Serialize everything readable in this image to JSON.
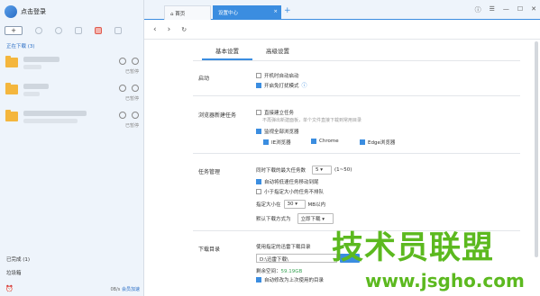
{
  "sidebar": {
    "login_label": "点击登录",
    "toolbar": {
      "add_label": "+"
    },
    "section_label": "正在下载 (3)",
    "items": [
      {
        "status": "已暂停"
      },
      {
        "status": "已暂停"
      },
      {
        "status": "已暂停"
      }
    ],
    "completed_label": "已完成 (1)",
    "recycle_label": "垃圾箱",
    "speed": "0B/s",
    "vip_link": "会员加速"
  },
  "tabs": [
    {
      "label": "首页"
    },
    {
      "label": "设置中心",
      "close": "×"
    }
  ],
  "new_tab": "+",
  "window_controls": [
    "ⓘ",
    "☰",
    "—",
    "☐",
    "✕"
  ],
  "nav": {
    "back": "‹",
    "forward": "›",
    "refresh": "↻"
  },
  "settings": {
    "tabs": [
      "基本设置",
      "高级设置"
    ],
    "startup": {
      "title": "启动",
      "options": [
        {
          "label": "开机时自动启动",
          "checked": false
        },
        {
          "label": "开启免打扰模式",
          "checked": true
        }
      ]
    },
    "browser_task": {
      "title": "浏览器新建任务",
      "direct": {
        "label": "直接建立任务",
        "checked": false
      },
      "direct_note": "不再弹出新建面板，单个文件直接下载到常用目录",
      "monitor": {
        "label": "监视全部浏览器",
        "checked": true
      },
      "browsers": [
        {
          "label": "IE浏览器",
          "checked": true
        },
        {
          "label": "Chrome",
          "checked": true
        },
        {
          "label": "Edge浏览器",
          "checked": true
        }
      ]
    },
    "task_mgmt": {
      "title": "任务管理",
      "max_label": "同时下载的最大任务数",
      "max_value": "5",
      "max_range": "(1~50)",
      "auto_move": {
        "label": "自动将低速任务移动到尾",
        "checked": true
      },
      "small_first": {
        "label": "小于指定大小的任务不排队",
        "checked": false
      },
      "size_label": "指定大小在",
      "size_value": "30",
      "size_unit": "MB以内",
      "mode_label": "默认下载方式为",
      "mode_value": "立即下载"
    },
    "dir": {
      "title": "下载目录",
      "use_label": "使用指定的迅雷下载目录",
      "use_checked": true,
      "path": "D:\\迅雷下载\\",
      "free_label": "剩余空间：",
      "free_value": "59.19GB",
      "auto_mod": {
        "label": "自动修改为上次使用的目录",
        "checked": true
      }
    }
  },
  "watermark": {
    "text": "技术员联盟",
    "url": "www.jsgho.com"
  }
}
